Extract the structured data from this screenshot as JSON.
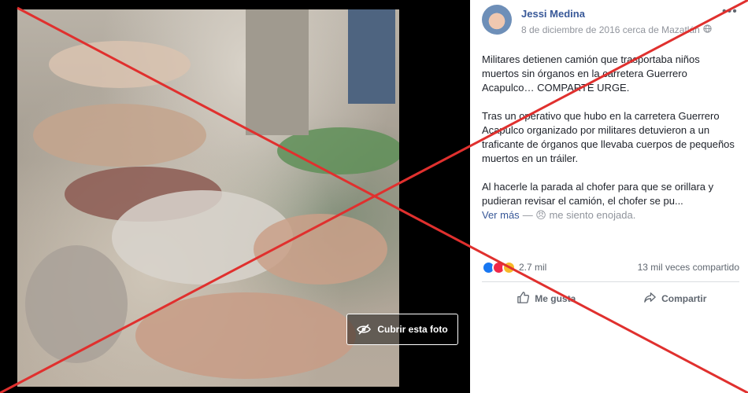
{
  "photo": {
    "cover_button_label": "Cubrir esta foto"
  },
  "post": {
    "author": "Jessi Medina",
    "meta_text": "8 de diciembre de 2016 cerca de Mazatlán",
    "privacy_icon": "globe-icon",
    "more_icon": "more-icon",
    "paragraphs": [
      "Militares detienen camión que trasportaba niños muertos sin órganos en la carretera Guerrero Acapulco… COMPARTE URGE.",
      "Tras un operativo que hubo en la carretera Guerrero Acapulco organizado por militares detuvieron a un traficante de órganos que llevaba cuerpos de pequeños muertos en un tráiler.",
      "Al hacerle la parada al chofer para que se orillara y pudieran revisar el camión, el chofer se pu..."
    ],
    "see_more": "Ver más",
    "feeling": "— 😠 me siento enojada."
  },
  "reactions": {
    "count": "2.7 mil",
    "shares": "13 mil veces compartido",
    "colors": [
      "#1877f2",
      "#f02849",
      "#f7b928"
    ]
  },
  "actions": {
    "like": "Me gusta",
    "share": "Compartir"
  },
  "overlay": {
    "cross_color": "#e0302e"
  }
}
